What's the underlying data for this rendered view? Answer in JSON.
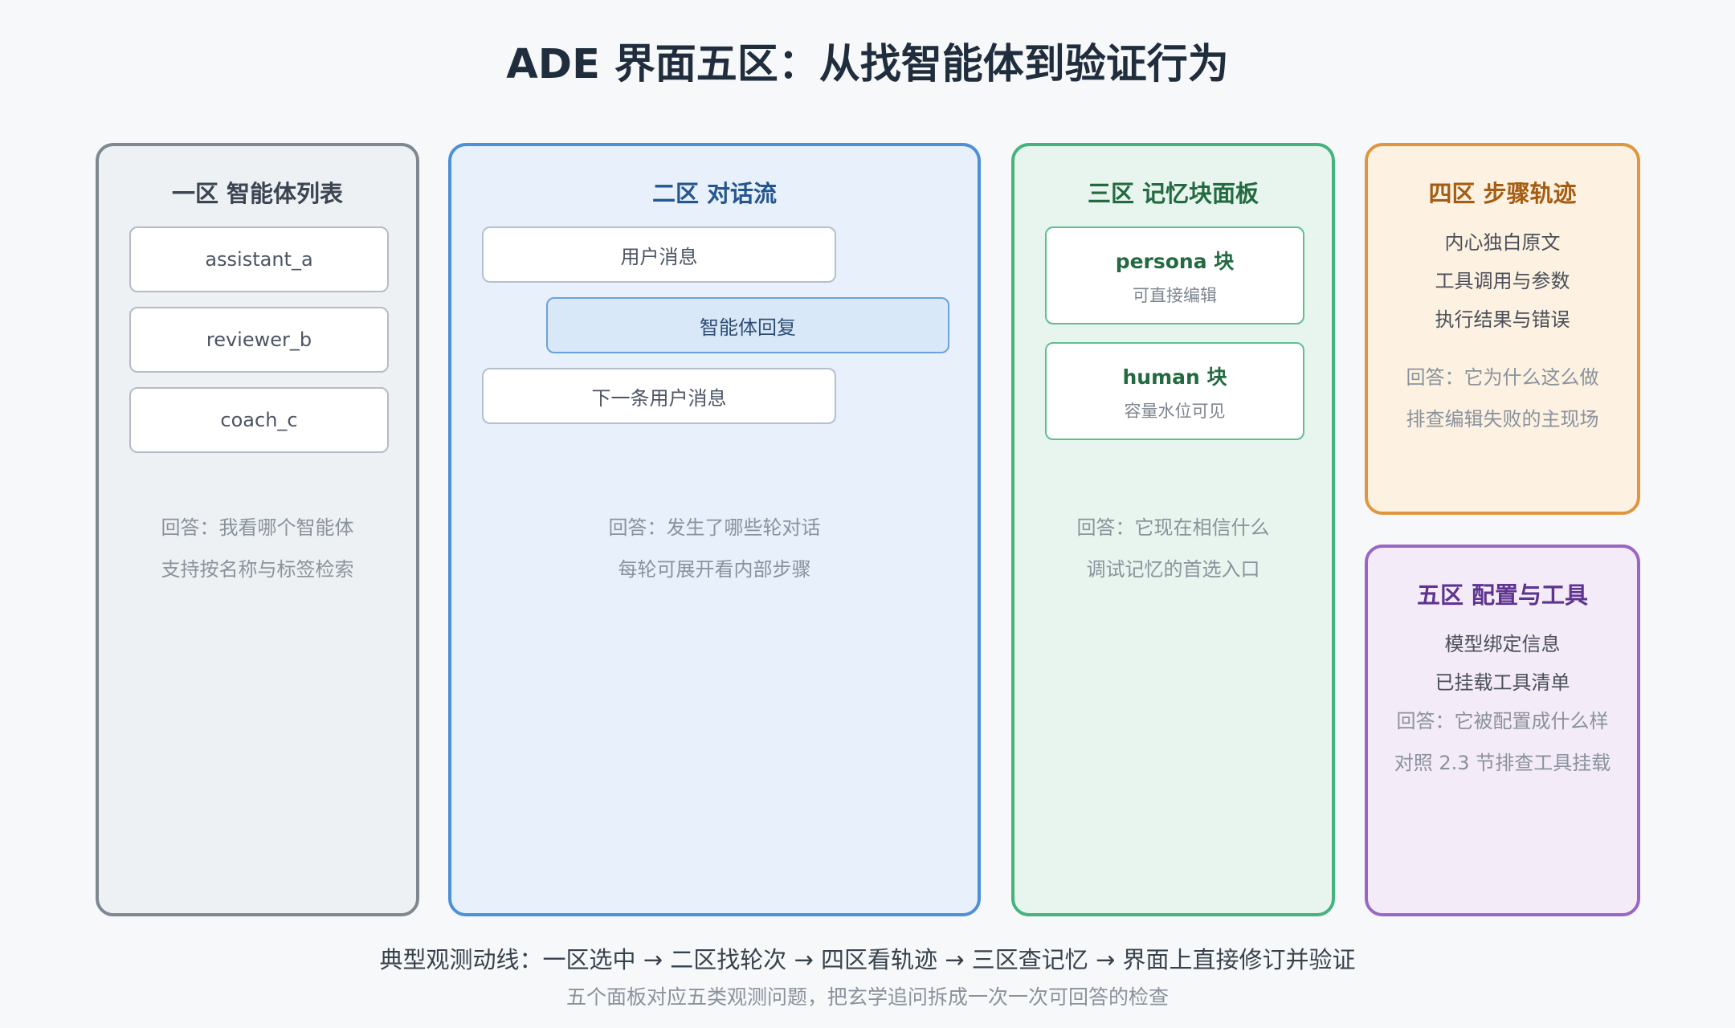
{
  "title": "ADE 界面五区：从找智能体到验证行为",
  "zone1": {
    "title": "一区 智能体列表",
    "agents": [
      "assistant_a",
      "reviewer_b",
      "coach_c"
    ],
    "notes": [
      "回答：我看哪个智能体",
      "支持按名称与标签检索"
    ]
  },
  "zone2": {
    "title": "二区 对话流",
    "user_message": "用户消息",
    "agent_reply": "智能体回复",
    "next_user_message": "下一条用户消息",
    "notes": [
      "回答：发生了哪些轮对话",
      "每轮可展开看内部步骤"
    ]
  },
  "zone3": {
    "title": "三区 记忆块面板",
    "blocks": [
      {
        "name": "persona 块",
        "desc": "可直接编辑"
      },
      {
        "name": "human 块",
        "desc": "容量水位可见"
      }
    ],
    "notes": [
      "回答：它现在相信什么",
      "调试记忆的首选入口"
    ]
  },
  "zone4": {
    "title": "四区 步骤轨迹",
    "items": [
      "内心独白原文",
      "工具调用与参数",
      "执行结果与错误"
    ],
    "notes": [
      "回答：它为什么这么做",
      "排查编辑失败的主现场"
    ]
  },
  "zone5": {
    "title": "五区 配置与工具",
    "items": [
      "模型绑定信息",
      "已挂载工具清单"
    ],
    "notes": [
      "回答：它被配置成什么样",
      "对照 2.3 节排查工具挂载"
    ]
  },
  "footer": {
    "flow": "典型观测动线：一区选中 → 二区找轮次 → 四区看轨迹 → 三区查记忆 → 界面上直接修订并验证",
    "summary": "五个面板对应五类观测问题，把玄学追问拆成一次一次可回答的检查"
  }
}
